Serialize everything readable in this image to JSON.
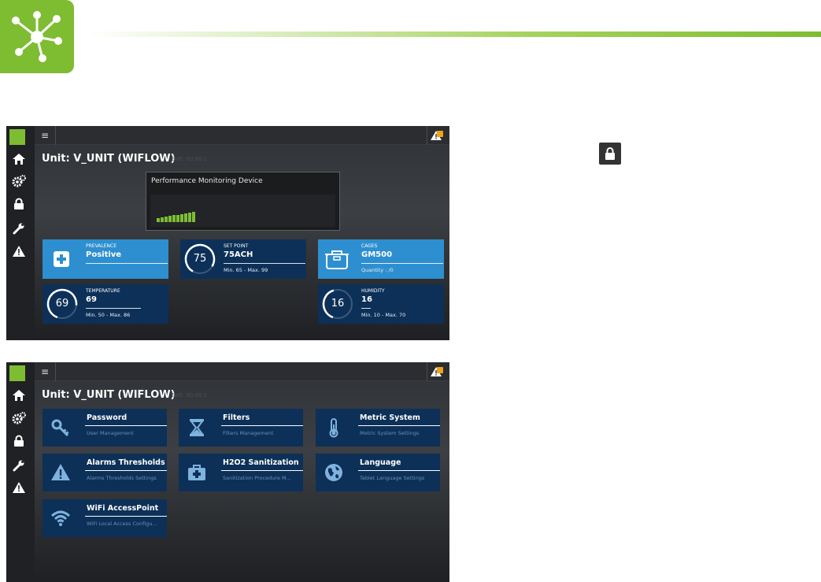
{
  "screen1": {
    "unit_title": "Unit: V_UNIT (WIFLOW)",
    "unit_sub": "Soft. 00.00.1",
    "performance_title": "Performance Monitoring Device",
    "performance_bars": 10,
    "tiles": {
      "prevalence": {
        "label": "PREVALENCE",
        "value": "Positive"
      },
      "setpoint": {
        "label": "SET POINT",
        "gauge": "75",
        "value": "75ACH",
        "foot": "Min. 65 - Max. 99"
      },
      "cages": {
        "label": "CAGES",
        "value": "GM500",
        "foot": "Quantity : /0"
      },
      "temperature": {
        "label": "TEMPERATURE",
        "gauge": "69",
        "value": "69",
        "foot": "Min. 50 - Max. 86"
      },
      "humidity": {
        "label": "HUMIDITY",
        "gauge": "16",
        "value": "16",
        "foot": "Min. 10 - Max. 70"
      }
    }
  },
  "screen2": {
    "unit_title": "Unit: V_UNIT (WIFLOW)",
    "unit_sub": "Soft. 00.00.1",
    "menu": [
      {
        "title": "Password",
        "sub": "User Management",
        "icon": "key-icon"
      },
      {
        "title": "Filters",
        "sub": "Filters Management",
        "icon": "hourglass-icon"
      },
      {
        "title": "Metric System",
        "sub": "Metric System Settings",
        "icon": "thermometer-icon"
      },
      {
        "title": "Alarms Thresholds",
        "sub": "Alarms Thresholds Settings",
        "icon": "warning-icon"
      },
      {
        "title": "H2O2 Sanitization",
        "sub": "Sanitization Procedure M...",
        "icon": "medical-kit-icon"
      },
      {
        "title": "Language",
        "sub": "Tablet Language Settings",
        "icon": "globe-icon"
      },
      {
        "title": "WiFi AccessPoint",
        "sub": "WiFi Local Access Configu...",
        "icon": "wifi-icon"
      }
    ]
  },
  "colors": {
    "brand_green": "#7ebd32",
    "tile_dark": "#0d3058",
    "tile_light": "#2d8fcf",
    "alert_orange": "#f1a21b"
  }
}
